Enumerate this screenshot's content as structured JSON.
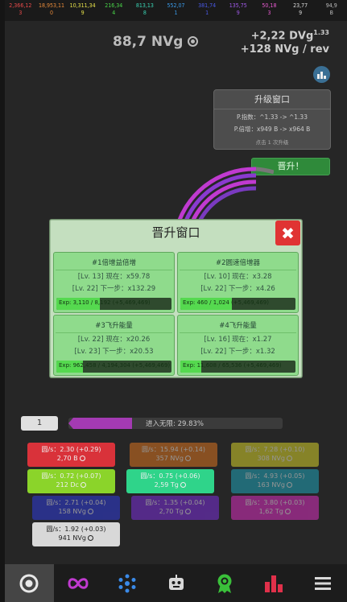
{
  "rings": [
    {
      "value": "2,366,12",
      "count": "3",
      "color": "#e84a4a"
    },
    {
      "value": "18,953,11",
      "count": "0",
      "color": "#e88a3a"
    },
    {
      "value": "10,311,34",
      "count": "9",
      "color": "#e6e14a"
    },
    {
      "value": "216,34",
      "count": "4",
      "color": "#4ad84a"
    },
    {
      "value": "813,13",
      "count": "8",
      "color": "#3ad4b4"
    },
    {
      "value": "552,07",
      "count": "1",
      "color": "#3a9ae8"
    },
    {
      "value": "381,74",
      "count": "1",
      "color": "#4a5ae8"
    },
    {
      "value": "135,75",
      "count": "9",
      "color": "#a05ae8"
    },
    {
      "value": "50,18",
      "count": "3",
      "color": "#e85ad0"
    },
    {
      "value": "23,77",
      "count": "9",
      "color": "#dddddd"
    },
    {
      "value": "94,9",
      "count": "B",
      "color": "#bbbbbb"
    }
  ],
  "currency": {
    "main": "88,7 NVg"
  },
  "rates": {
    "dvg": "+2,22 DVg",
    "dvg_exp": "1.33",
    "nvg": "+128 NVg / rev"
  },
  "upgrade_window": {
    "title": "升级窗口",
    "line1": "P.指数：^1.33 -> ^1.33",
    "line2": "P.倍增：x949 B -> x964 B",
    "note": "点击 1 次升级"
  },
  "promote_label": "晋升！",
  "dialog": {
    "title": "晋升窗口",
    "close": "✖",
    "cards": [
      {
        "title": "#1倍增益倍增",
        "line1": "[Lv. 13] 现在：x59.78",
        "line2": "[Lv. 22] 下一步：x132.29",
        "exp": "Exp: 3,110 / 8,192 (+5,469,469)",
        "progress": 0.38
      },
      {
        "title": "#2圆速倍增器",
        "line1": "[Lv. 10] 现在：x3.28",
        "line2": "[Lv. 22] 下一步：x4.26",
        "exp": "Exp: 460 / 1,024 (+5,469,469)",
        "progress": 0.45
      },
      {
        "title": "#3飞升能量",
        "line1": "[Lv. 22] 现在：x20.26",
        "line2": "[Lv. 23] 下一步：x20.53",
        "exp": "Exp: 962,458 / 4,194,304 (+5,469,469)",
        "progress": 0.23
      },
      {
        "title": "#4飞升能量",
        "line1": "[Lv. 16] 现在：x1.27",
        "line2": "[Lv. 22] 下一步：x1.32",
        "exp": "Exp: 11,608 / 65,536 (+5,469,469)",
        "progress": 0.18
      }
    ]
  },
  "infinity": {
    "level": "1",
    "label": "进入无限: 29.83%",
    "progress": 0.2983
  },
  "generators": [
    {
      "rate": "圆/s：2.30 (+0.29)",
      "amount": "2,70 B",
      "color": "#d9323a"
    },
    {
      "rate": "圆/s：15.94 (+0.14)",
      "amount": "357 NVg",
      "color": "#d9731f"
    },
    {
      "rate": "圆/s：7.28 (+0.10)",
      "amount": "308 NVg",
      "color": "#d6cf2a"
    },
    {
      "rate": "圆/s：0.72 (+0.07)",
      "amount": "212 Dc",
      "color": "#8bd42a"
    },
    {
      "rate": "圆/s：0.75 (+0.06)",
      "amount": "2,59 Tg",
      "color": "#2fd48a"
    },
    {
      "rate": "圆/s：4.93 (+0.05)",
      "amount": "163 NVg",
      "color": "#1fa3b8"
    },
    {
      "rate": "圆/s：2.71 (+0.04)",
      "amount": "158 NVg",
      "color": "#2f3ad9"
    },
    {
      "rate": "圆/s：1.35 (+0.04)",
      "amount": "2,70 Tg",
      "color": "#7a2fd9"
    },
    {
      "rate": "圆/s：3.80 (+0.03)",
      "amount": "1,62 Tg",
      "color": "#d92fc0"
    },
    {
      "rate": "圆/s：1.92 (+0.03)",
      "amount": "941 NVg",
      "color": "#d8d8d8"
    }
  ],
  "nav": [
    {
      "name": "nav-ring-icon",
      "color": "#e8e8e8"
    },
    {
      "name": "nav-infinity-icon",
      "color": "#c03ad0"
    },
    {
      "name": "nav-cluster-icon",
      "color": "#3a8ae8"
    },
    {
      "name": "nav-robot-icon",
      "color": "#d8d8d8"
    },
    {
      "name": "nav-award-icon",
      "color": "#3ac03a"
    },
    {
      "name": "nav-stats-icon",
      "color": "#e0304a"
    },
    {
      "name": "nav-menu-icon",
      "color": "#d8d8d8"
    }
  ]
}
